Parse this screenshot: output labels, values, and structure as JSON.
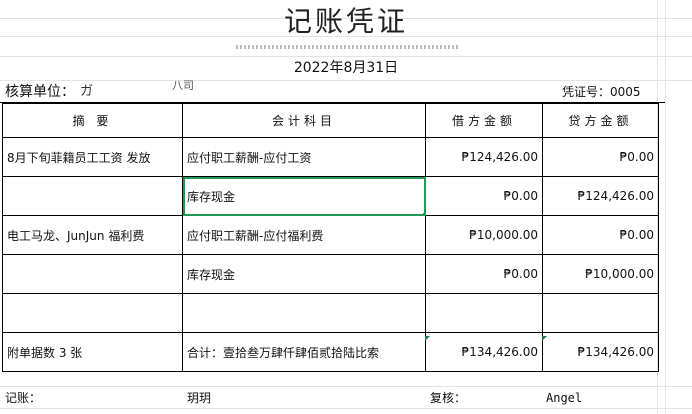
{
  "title": "记账凭证",
  "date": "2022年8月31日",
  "unit_label": "核算单位：",
  "unit_value": "ガ",
  "unit_value_tail": "八司",
  "voucher_no": "凭证号：0005",
  "headers": {
    "summary": "摘 要",
    "account": "会计科目",
    "debit": "借方金额",
    "credit": "贷方金额"
  },
  "rows": [
    {
      "summary": "8月下旬菲籍员工工资 发放",
      "account": "应付职工薪酬-应付工资",
      "debit": "₱124,426.00",
      "credit": "₱0.00"
    },
    {
      "summary": "",
      "account": "库存现金",
      "debit": "₱0.00",
      "credit": "₱124,426.00"
    },
    {
      "summary": "电工马龙、JunJun 福利费",
      "account": "应付职工薪酬-应付福利费",
      "debit": "₱10,000.00",
      "credit": "₱0.00"
    },
    {
      "summary": "",
      "account": "库存现金",
      "debit": "₱0.00",
      "credit": "₱10,000.00"
    },
    {
      "summary": "",
      "account": "",
      "debit": "",
      "credit": ""
    }
  ],
  "total": {
    "attachments": "附单据数 3 张",
    "label": "合计：壹拾叁万肆仟肆佰贰拾陆比索",
    "debit": "₱134,426.00",
    "credit": "₱134,426.00"
  },
  "footer": {
    "bookkeeper_label": "记账：",
    "bookkeeper_name": "玥玥",
    "reviewer_label": "复核：",
    "reviewer_name": "Angel"
  },
  "colors": {
    "selection": "#1e9a55",
    "grid": "#e3e3e3"
  }
}
